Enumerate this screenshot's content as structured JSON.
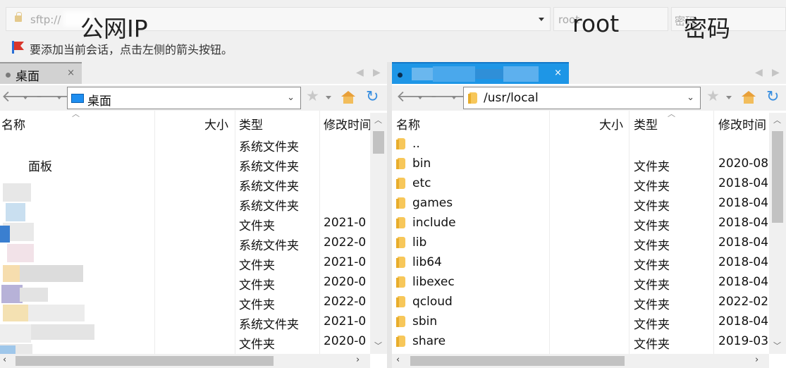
{
  "connection": {
    "url_placeholder": "sftp://",
    "user_placeholder": "root",
    "password_placeholder": "密码",
    "annotation_ip": "公网IP",
    "annotation_user": "root",
    "annotation_password": "密码"
  },
  "hint": "要添加当前会话，点击左侧的箭头按钮。",
  "left_pane": {
    "tab_label": "桌面",
    "tab_close": "×",
    "path": "桌面",
    "columns": [
      "名称",
      "大小",
      "类型",
      "修改时间"
    ],
    "rows": [
      {
        "name": "",
        "size": "",
        "type": "系统文件夹",
        "modified": ""
      },
      {
        "name": "面板",
        "size": "",
        "type": "系统文件夹",
        "modified": ""
      },
      {
        "name": "",
        "size": "",
        "type": "系统文件夹",
        "modified": ""
      },
      {
        "name": "",
        "size": "",
        "type": "系统文件夹",
        "modified": ""
      },
      {
        "name": "",
        "size": "",
        "type": "文件夹",
        "modified": "2021-0"
      },
      {
        "name": "",
        "size": "",
        "type": "系统文件夹",
        "modified": "2022-0"
      },
      {
        "name": "",
        "size": "",
        "type": "文件夹",
        "modified": "2021-0"
      },
      {
        "name": "",
        "size": "",
        "type": "文件夹",
        "modified": "2020-0"
      },
      {
        "name": "",
        "size": "",
        "type": "文件夹",
        "modified": "2022-0"
      },
      {
        "name": "",
        "size": "",
        "type": "系统文件夹",
        "modified": "2021-0"
      },
      {
        "name": "",
        "size": "",
        "type": "文件夹",
        "modified": "2020-0"
      }
    ]
  },
  "right_pane": {
    "tab_label": "",
    "tab_close": "×",
    "path": "/usr/local",
    "columns": [
      "名称",
      "大小",
      "类型",
      "修改时间"
    ],
    "rows": [
      {
        "name": "..",
        "size": "",
        "type": "",
        "modified": ""
      },
      {
        "name": "bin",
        "size": "",
        "type": "文件夹",
        "modified": "2020-08"
      },
      {
        "name": "etc",
        "size": "",
        "type": "文件夹",
        "modified": "2018-04"
      },
      {
        "name": "games",
        "size": "",
        "type": "文件夹",
        "modified": "2018-04"
      },
      {
        "name": "include",
        "size": "",
        "type": "文件夹",
        "modified": "2018-04"
      },
      {
        "name": "lib",
        "size": "",
        "type": "文件夹",
        "modified": "2018-04"
      },
      {
        "name": "lib64",
        "size": "",
        "type": "文件夹",
        "modified": "2018-04"
      },
      {
        "name": "libexec",
        "size": "",
        "type": "文件夹",
        "modified": "2018-04"
      },
      {
        "name": "qcloud",
        "size": "",
        "type": "文件夹",
        "modified": "2022-02"
      },
      {
        "name": "sbin",
        "size": "",
        "type": "文件夹",
        "modified": "2018-04"
      },
      {
        "name": "share",
        "size": "",
        "type": "文件夹",
        "modified": "2019-03"
      }
    ]
  },
  "icons": {
    "back": "arrow-left-icon",
    "forward": "arrow-right-icon",
    "favorite": "star-icon",
    "home": "home-icon",
    "refresh": "refresh-icon",
    "folder": "folder-icon",
    "desktop": "desktop-icon",
    "lock": "lock-icon",
    "flag": "flag-icon"
  },
  "colors": {
    "active_tab": "#1e96e6",
    "inactive_tab": "#d2d2d2",
    "folder": "#f7c75a",
    "hint_flag_red": "#d9362b",
    "hint_flag_blue": "#2a6fd6"
  }
}
